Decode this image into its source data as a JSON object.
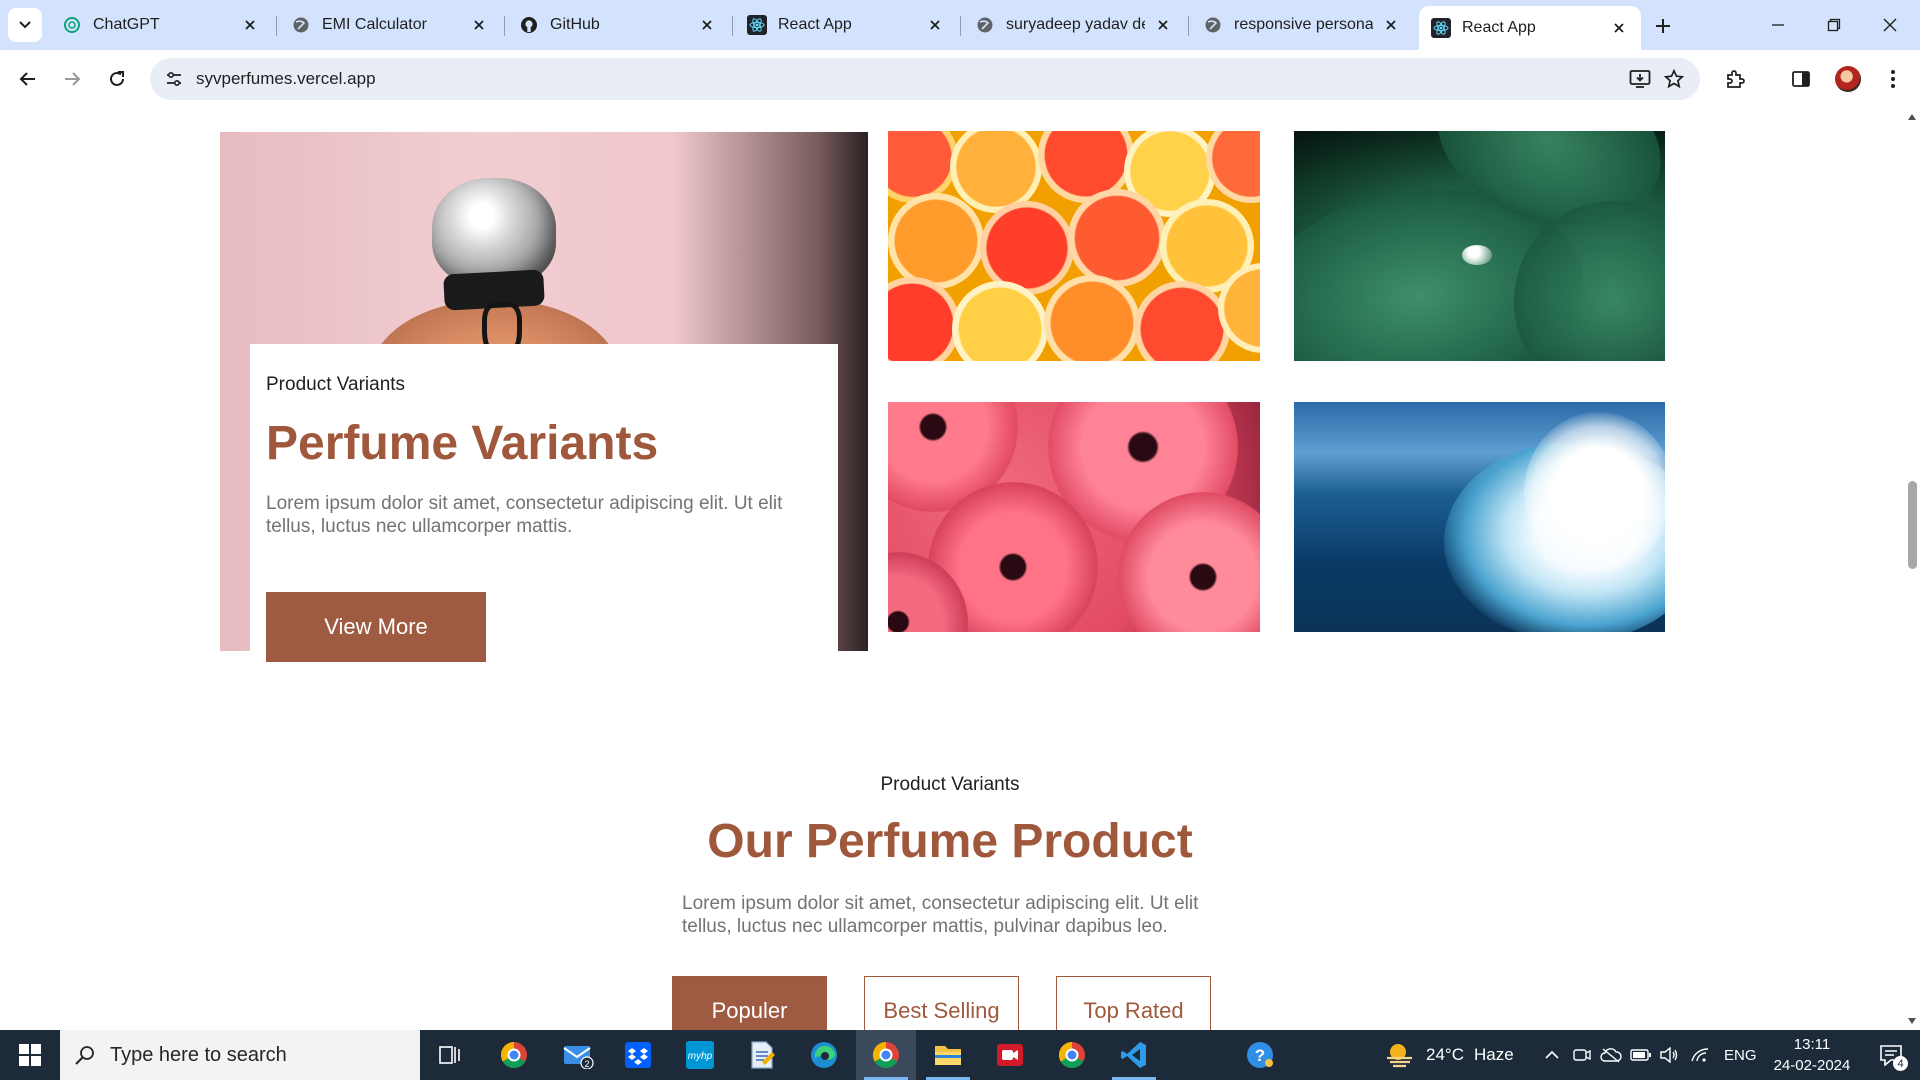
{
  "browser": {
    "tabs": [
      {
        "title": "ChatGPT",
        "favicon": "chatgpt-icon",
        "active": false
      },
      {
        "title": "EMI Calculator",
        "favicon": "globe-icon",
        "active": false
      },
      {
        "title": "GitHub",
        "favicon": "github-icon",
        "active": false
      },
      {
        "title": "React App",
        "favicon": "react-icon",
        "active": false
      },
      {
        "title": "suryadeep yadav dev",
        "favicon": "globe-icon",
        "active": false
      },
      {
        "title": "responsive personal",
        "favicon": "globe-icon",
        "active": false
      },
      {
        "title": "React App",
        "favicon": "react-icon",
        "active": true
      }
    ],
    "url": "syvperfumes.vercel.app"
  },
  "hero": {
    "eyebrow": "Product Variants",
    "title": "Perfume Variants",
    "text": "Lorem ipsum dolor sit amet, consectetur adipiscing elit. Ut elit tellus, luctus nec ullamcorper mattis.",
    "button_label": "View More"
  },
  "gallery": {
    "tiles": [
      "citrus-slices-image",
      "green-leaf-dewdrop-image",
      "pink-gerbera-flowers-image",
      "ocean-wave-image"
    ]
  },
  "products": {
    "eyebrow": "Product Variants",
    "title": "Our Perfume Product",
    "text": "Lorem ipsum dolor sit amet, consectetur adipiscing elit. Ut elit tellus, luctus nec ullamcorper mattis, pulvinar dapibus leo.",
    "filters": [
      {
        "label": "Populer",
        "active": true
      },
      {
        "label": "Best Selling",
        "active": false
      },
      {
        "label": "Top Rated",
        "active": false
      }
    ]
  },
  "taskbar": {
    "search_placeholder": "Type here to search",
    "mail_badge": "2",
    "weather": {
      "temp": "24°C",
      "condition": "Haze"
    },
    "language": "ENG",
    "time": "13:11",
    "date": "24-02-2024",
    "notification_count": "4"
  },
  "colors": {
    "accent": "#a0583d",
    "button": "#9f5b42",
    "tabstrip": "#d3e3fd",
    "taskbar": "#1c2a3a"
  }
}
